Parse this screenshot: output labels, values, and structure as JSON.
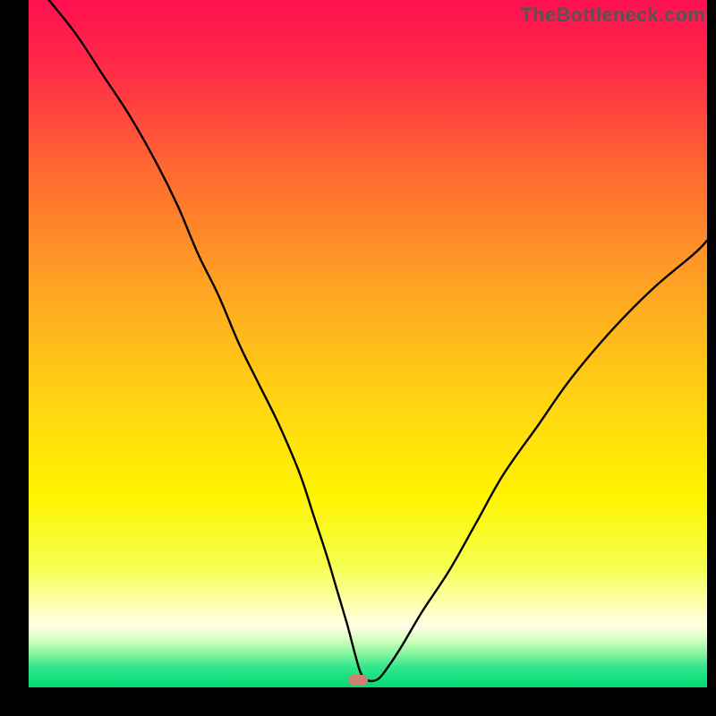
{
  "watermark": {
    "text": "TheBottleneck.com"
  },
  "chart_data": {
    "type": "line",
    "title": "",
    "xlabel": "",
    "ylabel": "",
    "xlim": [
      0,
      100
    ],
    "ylim": [
      0,
      100
    ],
    "grid": false,
    "legend": false,
    "gradient_colors": {
      "top": "#ff1846",
      "upper_mid": "#ff8a2a",
      "mid": "#ffe800",
      "lower_mid": "#f8ff70",
      "pale_band": "#fdffc8",
      "green": "#00e37a"
    },
    "series": [
      {
        "name": "bottleneck-curve",
        "stroke": "#000000",
        "stroke_width": 2.2,
        "x": [
          3,
          7,
          11,
          15,
          19,
          22,
          25,
          28,
          31,
          34,
          37,
          40,
          42,
          44,
          45.5,
          47,
          48.2,
          49,
          50,
          51.5,
          53,
          55,
          58,
          62,
          66,
          70,
          75,
          80,
          86,
          92,
          98,
          100
        ],
        "y_pct": [
          100,
          95,
          89,
          83,
          76,
          70,
          63,
          57,
          50,
          44,
          38,
          31,
          25,
          19,
          14,
          9,
          4.5,
          2,
          1,
          1.2,
          3,
          6,
          11,
          17,
          24,
          31,
          38,
          45,
          52,
          58,
          63,
          65
        ]
      }
    ],
    "marker": {
      "x_pct": 48.5,
      "y_pct_from_top": 99.0,
      "color": "#d08070"
    },
    "notes": "y_pct is percentage from the bottom of the plot area (0 = bottom, 100 = top). Values are estimated from the rendered curve against the gradient bands."
  }
}
